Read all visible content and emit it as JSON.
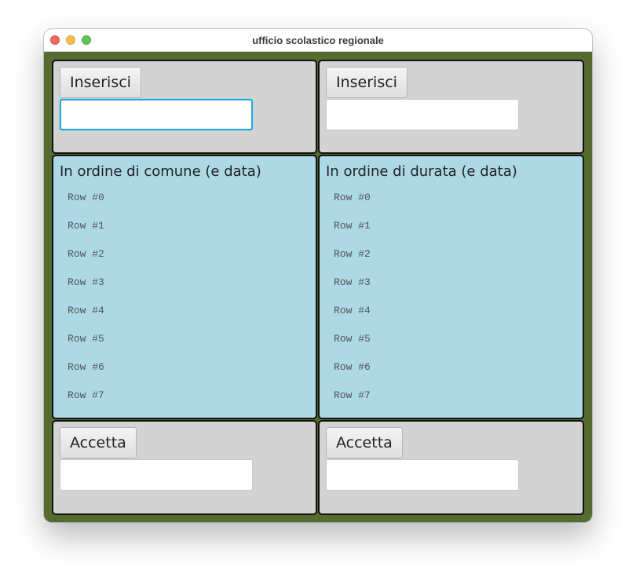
{
  "window": {
    "title": "ufficio scolastico regionale"
  },
  "top_left": {
    "button_label": "Inserisci",
    "input_value": ""
  },
  "top_right": {
    "button_label": "Inserisci",
    "input_value": ""
  },
  "middle_left": {
    "heading": "In ordine di comune (e data)",
    "rows": [
      "Row #0",
      "Row #1",
      "Row #2",
      "Row #3",
      "Row #4",
      "Row #5",
      "Row #6",
      "Row #7"
    ]
  },
  "middle_right": {
    "heading": "In ordine di durata (e data)",
    "rows": [
      "Row #0",
      "Row #1",
      "Row #2",
      "Row #3",
      "Row #4",
      "Row #5",
      "Row #6",
      "Row #7"
    ]
  },
  "bottom_left": {
    "button_label": "Accetta",
    "input_value": ""
  },
  "bottom_right": {
    "button_label": "Accetta",
    "input_value": ""
  },
  "colors": {
    "window_background": "#556b2f",
    "panel_gray": "#d3d3d3",
    "panel_blue": "#add8e6",
    "focus_ring": "#2aa6d6"
  }
}
